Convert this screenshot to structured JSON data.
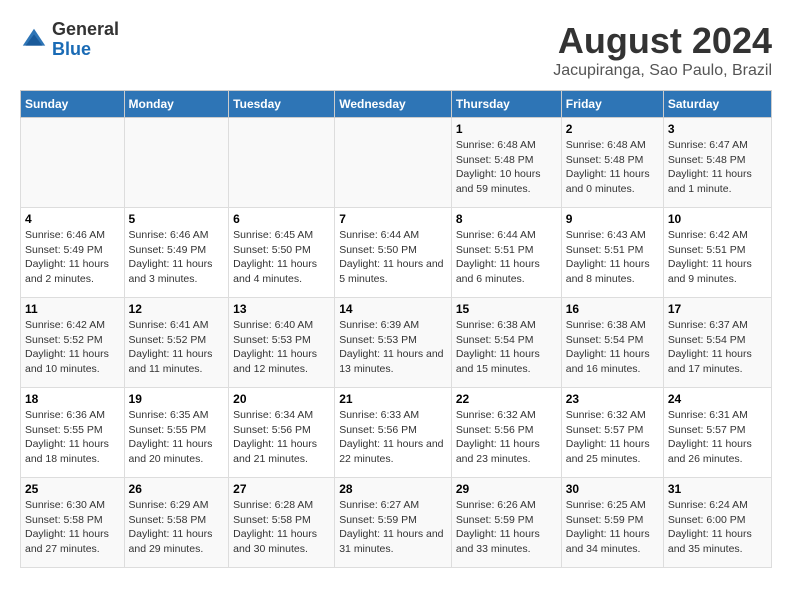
{
  "logo": {
    "general": "General",
    "blue": "Blue"
  },
  "title": "August 2024",
  "subtitle": "Jacupiranga, Sao Paulo, Brazil",
  "days_header": [
    "Sunday",
    "Monday",
    "Tuesday",
    "Wednesday",
    "Thursday",
    "Friday",
    "Saturday"
  ],
  "weeks": [
    [
      {
        "day": "",
        "info": ""
      },
      {
        "day": "",
        "info": ""
      },
      {
        "day": "",
        "info": ""
      },
      {
        "day": "",
        "info": ""
      },
      {
        "day": "1",
        "info": "Sunrise: 6:48 AM\nSunset: 5:48 PM\nDaylight: 10 hours and 59 minutes."
      },
      {
        "day": "2",
        "info": "Sunrise: 6:48 AM\nSunset: 5:48 PM\nDaylight: 11 hours and 0 minutes."
      },
      {
        "day": "3",
        "info": "Sunrise: 6:47 AM\nSunset: 5:48 PM\nDaylight: 11 hours and 1 minute."
      }
    ],
    [
      {
        "day": "4",
        "info": "Sunrise: 6:46 AM\nSunset: 5:49 PM\nDaylight: 11 hours and 2 minutes."
      },
      {
        "day": "5",
        "info": "Sunrise: 6:46 AM\nSunset: 5:49 PM\nDaylight: 11 hours and 3 minutes."
      },
      {
        "day": "6",
        "info": "Sunrise: 6:45 AM\nSunset: 5:50 PM\nDaylight: 11 hours and 4 minutes."
      },
      {
        "day": "7",
        "info": "Sunrise: 6:44 AM\nSunset: 5:50 PM\nDaylight: 11 hours and 5 minutes."
      },
      {
        "day": "8",
        "info": "Sunrise: 6:44 AM\nSunset: 5:51 PM\nDaylight: 11 hours and 6 minutes."
      },
      {
        "day": "9",
        "info": "Sunrise: 6:43 AM\nSunset: 5:51 PM\nDaylight: 11 hours and 8 minutes."
      },
      {
        "day": "10",
        "info": "Sunrise: 6:42 AM\nSunset: 5:51 PM\nDaylight: 11 hours and 9 minutes."
      }
    ],
    [
      {
        "day": "11",
        "info": "Sunrise: 6:42 AM\nSunset: 5:52 PM\nDaylight: 11 hours and 10 minutes."
      },
      {
        "day": "12",
        "info": "Sunrise: 6:41 AM\nSunset: 5:52 PM\nDaylight: 11 hours and 11 minutes."
      },
      {
        "day": "13",
        "info": "Sunrise: 6:40 AM\nSunset: 5:53 PM\nDaylight: 11 hours and 12 minutes."
      },
      {
        "day": "14",
        "info": "Sunrise: 6:39 AM\nSunset: 5:53 PM\nDaylight: 11 hours and 13 minutes."
      },
      {
        "day": "15",
        "info": "Sunrise: 6:38 AM\nSunset: 5:54 PM\nDaylight: 11 hours and 15 minutes."
      },
      {
        "day": "16",
        "info": "Sunrise: 6:38 AM\nSunset: 5:54 PM\nDaylight: 11 hours and 16 minutes."
      },
      {
        "day": "17",
        "info": "Sunrise: 6:37 AM\nSunset: 5:54 PM\nDaylight: 11 hours and 17 minutes."
      }
    ],
    [
      {
        "day": "18",
        "info": "Sunrise: 6:36 AM\nSunset: 5:55 PM\nDaylight: 11 hours and 18 minutes."
      },
      {
        "day": "19",
        "info": "Sunrise: 6:35 AM\nSunset: 5:55 PM\nDaylight: 11 hours and 20 minutes."
      },
      {
        "day": "20",
        "info": "Sunrise: 6:34 AM\nSunset: 5:56 PM\nDaylight: 11 hours and 21 minutes."
      },
      {
        "day": "21",
        "info": "Sunrise: 6:33 AM\nSunset: 5:56 PM\nDaylight: 11 hours and 22 minutes."
      },
      {
        "day": "22",
        "info": "Sunrise: 6:32 AM\nSunset: 5:56 PM\nDaylight: 11 hours and 23 minutes."
      },
      {
        "day": "23",
        "info": "Sunrise: 6:32 AM\nSunset: 5:57 PM\nDaylight: 11 hours and 25 minutes."
      },
      {
        "day": "24",
        "info": "Sunrise: 6:31 AM\nSunset: 5:57 PM\nDaylight: 11 hours and 26 minutes."
      }
    ],
    [
      {
        "day": "25",
        "info": "Sunrise: 6:30 AM\nSunset: 5:58 PM\nDaylight: 11 hours and 27 minutes."
      },
      {
        "day": "26",
        "info": "Sunrise: 6:29 AM\nSunset: 5:58 PM\nDaylight: 11 hours and 29 minutes."
      },
      {
        "day": "27",
        "info": "Sunrise: 6:28 AM\nSunset: 5:58 PM\nDaylight: 11 hours and 30 minutes."
      },
      {
        "day": "28",
        "info": "Sunrise: 6:27 AM\nSunset: 5:59 PM\nDaylight: 11 hours and 31 minutes."
      },
      {
        "day": "29",
        "info": "Sunrise: 6:26 AM\nSunset: 5:59 PM\nDaylight: 11 hours and 33 minutes."
      },
      {
        "day": "30",
        "info": "Sunrise: 6:25 AM\nSunset: 5:59 PM\nDaylight: 11 hours and 34 minutes."
      },
      {
        "day": "31",
        "info": "Sunrise: 6:24 AM\nSunset: 6:00 PM\nDaylight: 11 hours and 35 minutes."
      }
    ]
  ]
}
